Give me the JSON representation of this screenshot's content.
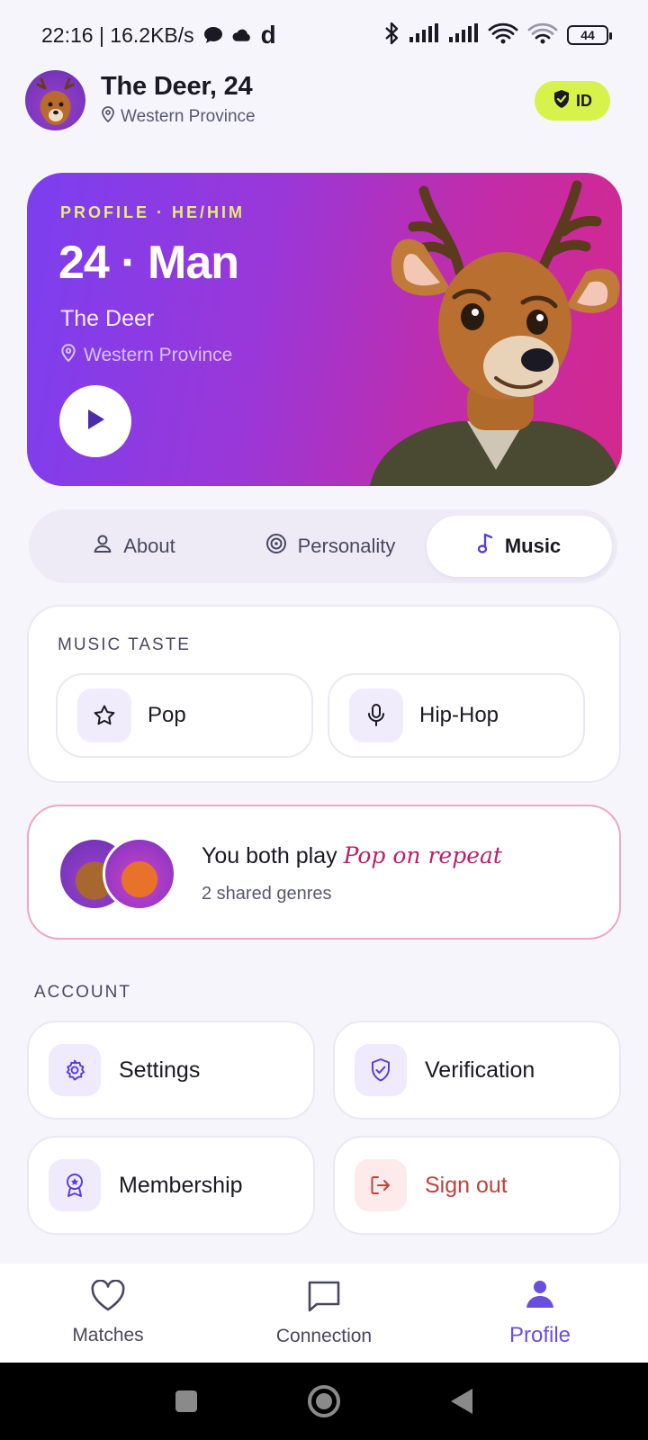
{
  "status_bar": {
    "time_and_speed": "22:16 | 16.2KB/s",
    "extra_glyph": "d",
    "battery": "44"
  },
  "header": {
    "name": "The Deer, 24",
    "location": "Western Province",
    "badge": "ID"
  },
  "hero": {
    "kicker": "PROFILE · HE/HIM",
    "title": "24 · Man",
    "name": "The Deer",
    "location": "Western Province"
  },
  "tabs": [
    {
      "label": "About",
      "icon": "person-icon"
    },
    {
      "label": "Personality",
      "icon": "target-icon"
    },
    {
      "label": "Music",
      "icon": "music-note-icon",
      "active": true
    }
  ],
  "music": {
    "section_label": "MUSIC TASTE",
    "genres": [
      {
        "label": "Pop",
        "icon": "star-icon"
      },
      {
        "label": "Hip-Hop",
        "icon": "microphone-icon"
      }
    ]
  },
  "shared": {
    "title_prefix": "You both play",
    "title_highlight": "Pop on repeat",
    "subtitle": "2 shared genres"
  },
  "account": {
    "section_label": "ACCOUNT",
    "items": [
      {
        "label": "Settings",
        "icon": "gear-icon"
      },
      {
        "label": "Verification",
        "icon": "shield-check-icon"
      },
      {
        "label": "Membership",
        "icon": "award-icon"
      },
      {
        "label": "Sign out",
        "icon": "sign-out-icon"
      }
    ]
  },
  "bottom_nav": [
    {
      "label": "Matches",
      "icon": "heart-icon"
    },
    {
      "label": "Connection",
      "icon": "chat-icon"
    },
    {
      "label": "Profile",
      "icon": "profile-icon",
      "active": true
    }
  ],
  "colors": {
    "accent": "#6a4ee0",
    "id_badge": "#d7f24a",
    "highlight": "#b81f6e",
    "danger": "#c2413b"
  }
}
